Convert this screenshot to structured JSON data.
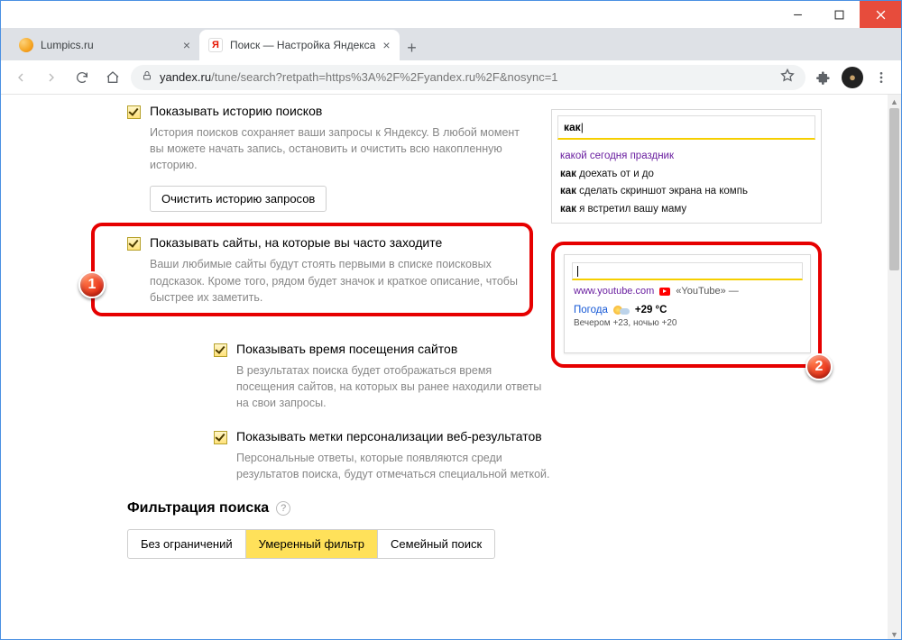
{
  "tabs": [
    {
      "title": "Lumpics.ru"
    },
    {
      "title": "Поиск — Настройка Яндекса",
      "favletter": "Я"
    }
  ],
  "url_host": "yandex.ru",
  "url_path": "/tune/search?retpath=https%3A%2F%2Fyandex.ru%2F&nosync=1",
  "opt1": {
    "title": "Показывать историю поисков",
    "desc": "История поисков сохраняет ваши запросы к Яндексу. В любой момент вы можете начать запись, остановить и очистить всю накопленную историю.",
    "clear": "Очистить историю запросов"
  },
  "opt2": {
    "title": "Показывать сайты, на которые вы часто заходите",
    "desc": "Ваши любимые сайты будут стоять первыми в списке поисковых подсказок. Кроме того, рядом будет значок и краткое описание, чтобы быстрее их заметить."
  },
  "opt3": {
    "title": "Показывать время посещения сайтов",
    "desc": "В результатах поиска будет отображаться время посещения сайтов, на которых вы ранее находили ответы на свои запросы."
  },
  "opt4": {
    "title": "Показывать метки персонализации веб-результатов",
    "desc": "Персональные ответы, которые появляются среди результатов поиска, будут отмечаться специальной меткой."
  },
  "filter": {
    "heading": "Фильтрация поиска",
    "a": "Без ограничений",
    "b": "Умеренный фильтр",
    "c": "Семейный поиск"
  },
  "preview1": {
    "typed_bold": "как",
    "s1": "какой сегодня праздник",
    "s2_b": "как",
    "s2_r": " доехать от и до",
    "s3_b": "как",
    "s3_r": " сделать скриншот экрана на компь",
    "s4_b": "как",
    "s4_r": " я встретил вашу маму"
  },
  "preview2": {
    "url": "www.youtube.com",
    "title": "«YouTube» —",
    "weather_lbl": "Погода",
    "temp": "+29 °C",
    "sub": "Вечером +23,  ночью +20"
  },
  "markers": {
    "one": "1",
    "two": "2"
  }
}
